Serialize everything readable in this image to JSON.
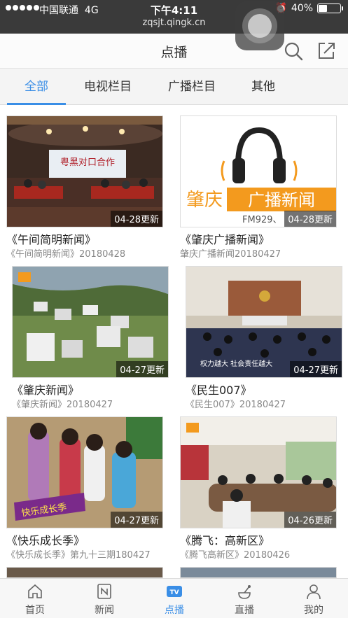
{
  "status_bar": {
    "carrier": "中国联通",
    "network": "4G",
    "time": "下午4:11",
    "battery": "40%",
    "battery_level": 0.4,
    "url": "zqsjt.qingk.cn"
  },
  "header": {
    "title": "点播",
    "search_icon": "search-icon",
    "share_icon": "share-icon"
  },
  "tabs": [
    {
      "label": "全部",
      "active": true
    },
    {
      "label": "电视栏目",
      "active": false
    },
    {
      "label": "广播栏目",
      "active": false
    },
    {
      "label": "其他",
      "active": false
    }
  ],
  "items": [
    {
      "title": "《午间简明新闻》",
      "subtitle": "《午间简明新闻》20180428",
      "badge": "04-28更新",
      "thumb_text": "粤黑对口合作"
    },
    {
      "title": "《肇庆广播新闻》",
      "subtitle": "肇庆广播新闻20180427",
      "badge": "04-28更新",
      "thumb_text_1": "肇庆",
      "thumb_text_2": "广播新闻",
      "thumb_text_3": "FM929、"
    },
    {
      "title": "《肇庆新闻》",
      "subtitle": "《肇庆新闻》20180427",
      "badge": "04-27更新"
    },
    {
      "title": "《民生007》",
      "subtitle": "《民生007》20180427",
      "badge": "04-27更新",
      "thumb_text": "权力越大 社会责任越大"
    },
    {
      "title": "《快乐成长季》",
      "subtitle": "《快乐成长季》第九十三期180427",
      "badge": "04-27更新",
      "thumb_text": "快乐成长季"
    },
    {
      "title": "《腾飞：高新区》",
      "subtitle": "《腾飞高新区》20180426",
      "badge": "04-26更新"
    }
  ],
  "bottom_nav": [
    {
      "label": "首页",
      "icon": "home-icon",
      "active": false
    },
    {
      "label": "新闻",
      "icon": "news-icon",
      "active": false
    },
    {
      "label": "点播",
      "icon": "tv-icon",
      "active": true
    },
    {
      "label": "直播",
      "icon": "broadcast-icon",
      "active": false
    },
    {
      "label": "我的",
      "icon": "user-icon",
      "active": false
    }
  ],
  "colors": {
    "accent": "#3a8ee6",
    "status_bar": "#3a3a3a",
    "radio_orange": "#f39a1e"
  }
}
